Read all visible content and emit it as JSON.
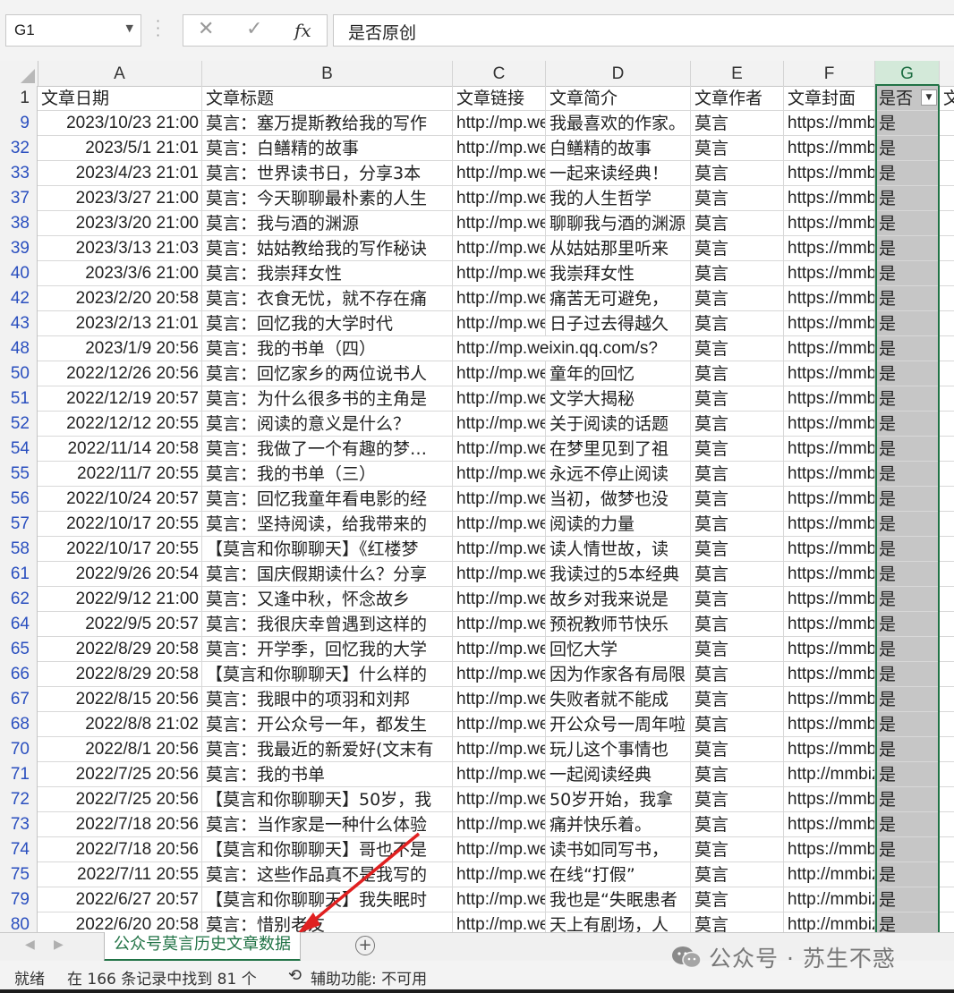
{
  "formula_bar": {
    "name_box": "G1",
    "cancel_icon": "✕",
    "enter_icon": "✓",
    "fx_label": "fx",
    "formula": "是否原创"
  },
  "columns": [
    "A",
    "B",
    "C",
    "D",
    "E",
    "F",
    "G"
  ],
  "header_row": {
    "row_number": "1",
    "cells": [
      "文章日期",
      "文章标题",
      "文章链接",
      "文章简介",
      "文章作者",
      "文章封面",
      "是否",
      "文"
    ]
  },
  "rows": [
    {
      "n": "9",
      "date": "2023/10/23 21:00",
      "title": "莫言：塞万提斯教给我的写作",
      "link": "http://mp.weixin",
      "intro": "我最喜欢的作家。",
      "author": "莫言",
      "cover": "https://mmbiz",
      "orig": "是"
    },
    {
      "n": "32",
      "date": "2023/5/1 21:01",
      "title": "莫言：白鳝精的故事",
      "link": "http://mp.weixin",
      "intro": "白鳝精的故事",
      "author": "莫言",
      "cover": "https://mmbiz",
      "orig": "是"
    },
    {
      "n": "33",
      "date": "2023/4/23 21:01",
      "title": "莫言：世界读书日，分享3本",
      "link": "http://mp.weixin",
      "intro": "一起来读经典！",
      "author": "莫言",
      "cover": "https://mmbiz",
      "orig": "是"
    },
    {
      "n": "37",
      "date": "2023/3/27 21:00",
      "title": "莫言：今天聊聊最朴素的人生",
      "link": "http://mp.weixin",
      "intro": "我的人生哲学",
      "author": "莫言",
      "cover": "https://mmbiz",
      "orig": "是"
    },
    {
      "n": "38",
      "date": "2023/3/20 21:00",
      "title": "莫言：我与酒的渊源",
      "link": "http://mp.weixin",
      "intro": "聊聊我与酒的渊源",
      "author": "莫言",
      "cover": "https://mmbiz",
      "orig": "是"
    },
    {
      "n": "39",
      "date": "2023/3/13 21:03",
      "title": "莫言：姑姑教给我的写作秘诀",
      "link": "http://mp.weixin",
      "intro": "从姑姑那里听来",
      "author": "莫言",
      "cover": "https://mmbiz",
      "orig": "是"
    },
    {
      "n": "40",
      "date": "2023/3/6 21:00",
      "title": "莫言：我崇拜女性",
      "link": "http://mp.weixin",
      "intro": "我崇拜女性",
      "author": "莫言",
      "cover": "https://mmbiz",
      "orig": "是"
    },
    {
      "n": "42",
      "date": "2023/2/20 20:58",
      "title": "莫言：衣食无忧，就不存在痛",
      "link": "http://mp.weixin",
      "intro": "痛苦无可避免，",
      "author": "莫言",
      "cover": "https://mmbiz",
      "orig": "是"
    },
    {
      "n": "43",
      "date": "2023/2/13 21:01",
      "title": "莫言：回忆我的大学时代",
      "link": "http://mp.weixin",
      "intro": "日子过去得越久",
      "author": "莫言",
      "cover": "https://mmbiz",
      "orig": "是"
    },
    {
      "n": "48",
      "date": "2023/1/9 20:56",
      "title": "莫言：我的书单（四）",
      "link": "http://mp.weixin.qq.com/s?",
      "intro": "",
      "author": "莫言",
      "cover": "https://mmbiz",
      "orig": "是"
    },
    {
      "n": "50",
      "date": "2022/12/26 20:56",
      "title": "莫言：回忆家乡的两位说书人",
      "link": "http://mp.weixin",
      "intro": "童年的回忆",
      "author": "莫言",
      "cover": "https://mmbiz",
      "orig": "是"
    },
    {
      "n": "51",
      "date": "2022/12/19 20:57",
      "title": "莫言：为什么很多书的主角是",
      "link": "http://mp.weixin",
      "intro": "文学大揭秘",
      "author": "莫言",
      "cover": "https://mmbiz",
      "orig": "是"
    },
    {
      "n": "52",
      "date": "2022/12/12 20:55",
      "title": "莫言：阅读的意义是什么？",
      "link": "http://mp.weixin",
      "intro": "关于阅读的话题",
      "author": "莫言",
      "cover": "https://mmbiz",
      "orig": "是"
    },
    {
      "n": "54",
      "date": "2022/11/14 20:58",
      "title": "莫言：我做了一个有趣的梦…",
      "link": "http://mp.weixin",
      "intro": "在梦里见到了祖",
      "author": "莫言",
      "cover": "https://mmbiz",
      "orig": "是"
    },
    {
      "n": "55",
      "date": "2022/11/7 20:55",
      "title": "莫言：我的书单（三）",
      "link": "http://mp.weixin",
      "intro": "永远不停止阅读",
      "author": "莫言",
      "cover": "https://mmbiz",
      "orig": "是"
    },
    {
      "n": "56",
      "date": "2022/10/24 20:57",
      "title": "莫言：回忆我童年看电影的经",
      "link": "http://mp.weixin",
      "intro": "当初，做梦也没",
      "author": "莫言",
      "cover": "https://mmbiz",
      "orig": "是"
    },
    {
      "n": "57",
      "date": "2022/10/17 20:55",
      "title": "莫言：坚持阅读，给我带来的",
      "link": "http://mp.weixin",
      "intro": "阅读的力量",
      "author": "莫言",
      "cover": "https://mmbiz",
      "orig": "是"
    },
    {
      "n": "58",
      "date": "2022/10/17 20:55",
      "title": "【莫言和你聊聊天】《红楼梦",
      "link": "http://mp.weixin",
      "intro": "读人情世故，读",
      "author": "莫言",
      "cover": "https://mmbiz",
      "orig": "是"
    },
    {
      "n": "61",
      "date": "2022/9/26 20:54",
      "title": "莫言：国庆假期读什么？分享",
      "link": "http://mp.weixin",
      "intro": "我读过的5本经典",
      "author": "莫言",
      "cover": "https://mmbiz",
      "orig": "是"
    },
    {
      "n": "62",
      "date": "2022/9/12 21:00",
      "title": "莫言：又逢中秋，怀念故乡",
      "link": "http://mp.weixin",
      "intro": "故乡对我来说是",
      "author": "莫言",
      "cover": "https://mmbiz",
      "orig": "是"
    },
    {
      "n": "64",
      "date": "2022/9/5 20:57",
      "title": "莫言：我很庆幸曾遇到这样的",
      "link": "http://mp.weixin",
      "intro": "预祝教师节快乐",
      "author": "莫言",
      "cover": "https://mmbiz",
      "orig": "是"
    },
    {
      "n": "65",
      "date": "2022/8/29 20:58",
      "title": "莫言：开学季，回忆我的大学",
      "link": "http://mp.weixin",
      "intro": "回忆大学",
      "author": "莫言",
      "cover": "https://mmbiz",
      "orig": "是"
    },
    {
      "n": "66",
      "date": "2022/8/29 20:58",
      "title": "【莫言和你聊聊天】什么样的",
      "link": "http://mp.weixin",
      "intro": "因为作家各有局限",
      "author": "莫言",
      "cover": "https://mmbiz",
      "orig": "是"
    },
    {
      "n": "67",
      "date": "2022/8/15 20:56",
      "title": "莫言：我眼中的项羽和刘邦",
      "link": "http://mp.weixin",
      "intro": "失败者就不能成",
      "author": "莫言",
      "cover": "https://mmbiz",
      "orig": "是"
    },
    {
      "n": "68",
      "date": "2022/8/8 21:02",
      "title": "莫言：开公众号一年，都发生",
      "link": "http://mp.weixin",
      "intro": "开公众号一周年啦",
      "author": "莫言",
      "cover": "https://mmbiz",
      "orig": "是"
    },
    {
      "n": "70",
      "date": "2022/8/1 20:56",
      "title": "莫言：我最近的新爱好(文末有",
      "link": "http://mp.weixin",
      "intro": "玩儿这个事情也",
      "author": "莫言",
      "cover": "https://mmbiz",
      "orig": "是"
    },
    {
      "n": "71",
      "date": "2022/7/25 20:56",
      "title": "莫言：我的书单",
      "link": "http://mp.weixin",
      "intro": "一起阅读经典",
      "author": "莫言",
      "cover": "http://mmbiz",
      "orig": "是"
    },
    {
      "n": "72",
      "date": "2022/7/25 20:56",
      "title": "【莫言和你聊聊天】50岁，我",
      "link": "http://mp.weixin",
      "intro": "50岁开始，我拿",
      "author": "莫言",
      "cover": "https://mmbiz",
      "orig": "是"
    },
    {
      "n": "73",
      "date": "2022/7/18 20:56",
      "title": "莫言：当作家是一种什么体验",
      "link": "http://mp.weixin",
      "intro": "痛并快乐着。",
      "author": "莫言",
      "cover": "https://mmbiz",
      "orig": "是"
    },
    {
      "n": "74",
      "date": "2022/7/18 20:56",
      "title": "【莫言和你聊聊天】哥也不是",
      "link": "http://mp.weixin",
      "intro": "读书如同写书，",
      "author": "莫言",
      "cover": "https://mmbiz",
      "orig": "是"
    },
    {
      "n": "75",
      "date": "2022/7/11 20:55",
      "title": "莫言：这些作品真不是我写的",
      "link": "http://mp.weixin",
      "intro": "在线“打假”",
      "author": "莫言",
      "cover": "http://mmbiz",
      "orig": "是"
    },
    {
      "n": "79",
      "date": "2022/6/27 20:57",
      "title": "【莫言和你聊聊天】我失眠时",
      "link": "http://mp.weixin",
      "intro": "我也是“失眠患者",
      "author": "莫言",
      "cover": "http://mmbiz",
      "orig": "是"
    },
    {
      "n": "80",
      "date": "2022/6/20 20:58",
      "title": "莫言：惜别老友",
      "link": "http://mp.weixin",
      "intro": "天上有剧场，人",
      "author": "莫言",
      "cover": "http://mmbiz",
      "orig": "是"
    }
  ],
  "sheet_tab": "公众号莫言历史文章数据",
  "status": {
    "ready": "就绪",
    "filter_result": "在 166 条记录中找到 81 个",
    "accessibility": "辅助功能: 不可用"
  },
  "watermark": "公众号 · 苏生不惑",
  "colors": {
    "accent": "#217346",
    "row_number": "#2a4fbf",
    "annotation_arrow": "#e02020"
  }
}
